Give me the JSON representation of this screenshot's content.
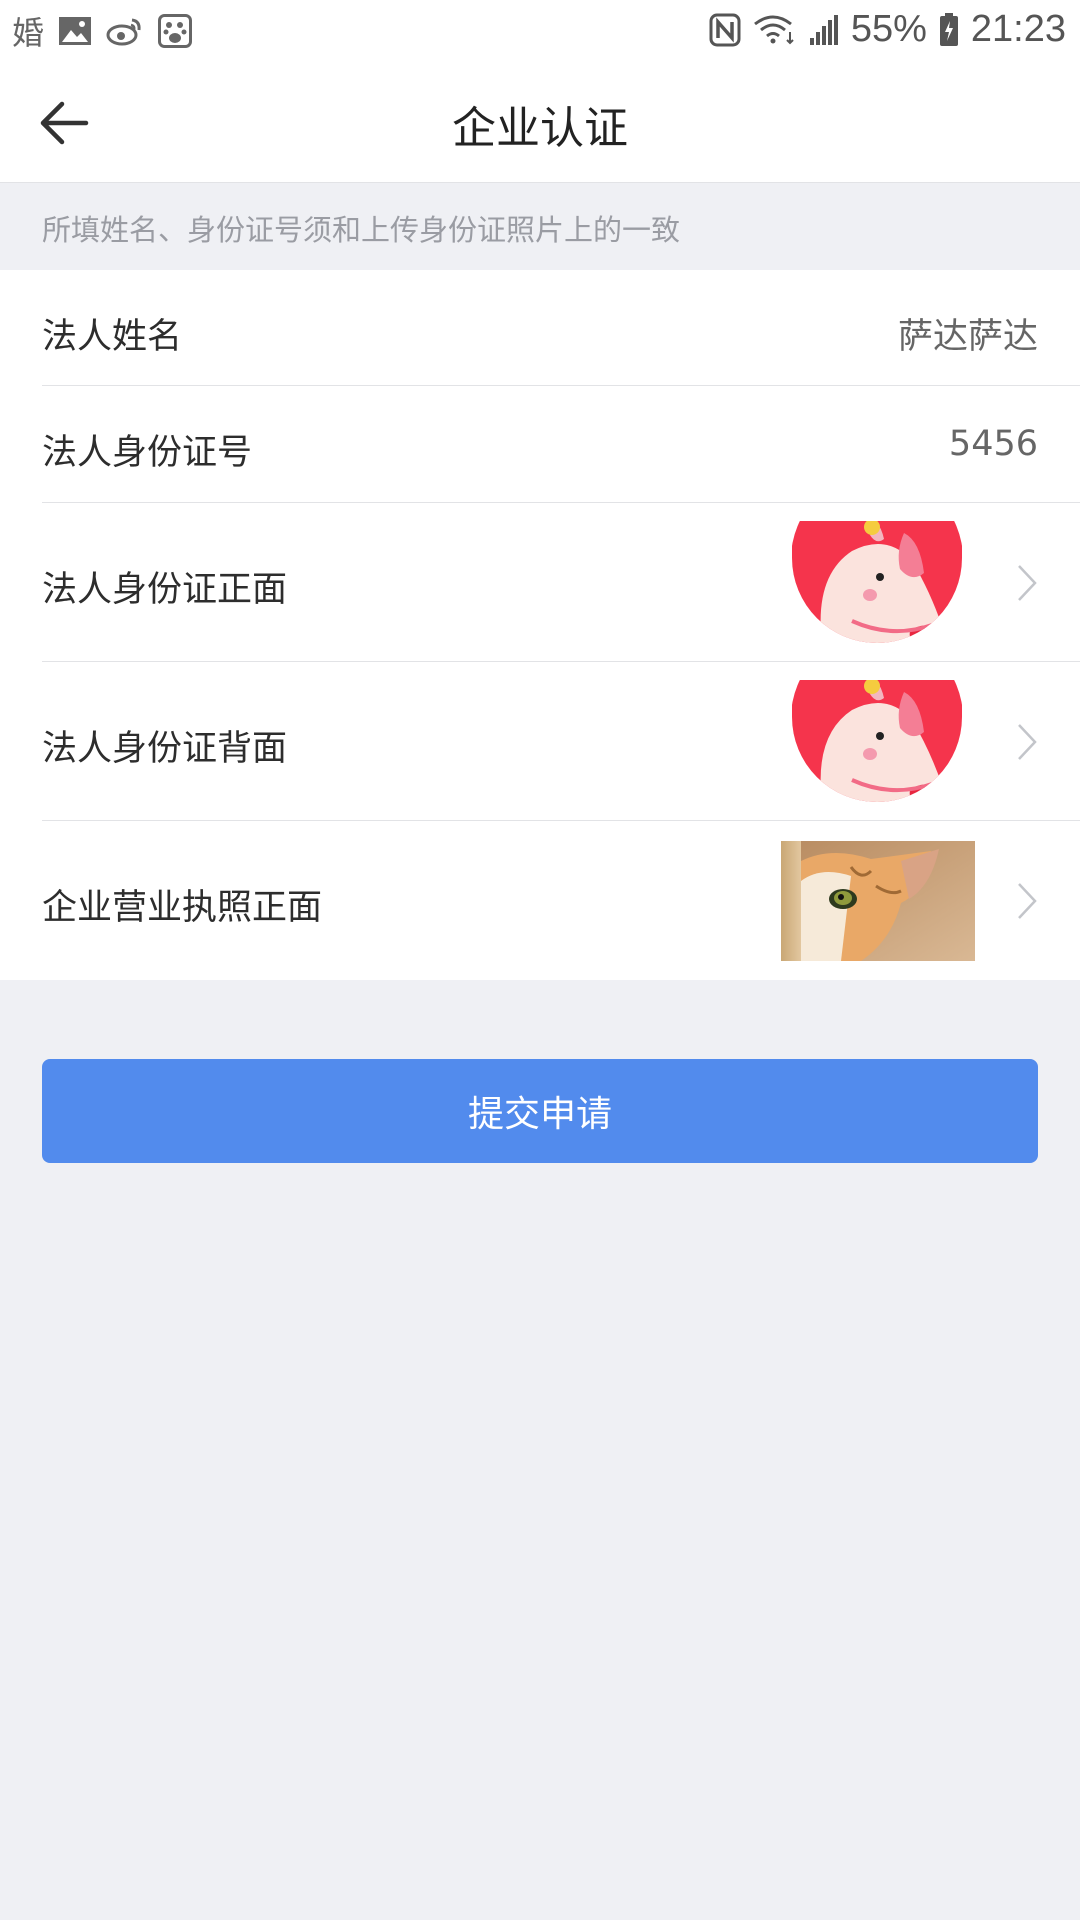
{
  "status_bar": {
    "left_char": "婚",
    "icons_left": [
      "image-icon",
      "weibo-icon",
      "baidu-icon"
    ],
    "icons_right": [
      "nfc-icon",
      "wifi-icon",
      "signal-icon",
      "battery-icon"
    ],
    "battery": "55%",
    "time": "21:23"
  },
  "header": {
    "title": "企业认证",
    "back_icon": "arrow-left-icon"
  },
  "notice": "所填姓名、身份证号须和上传身份证照片上的一致",
  "form": {
    "name_label": "法人姓名",
    "name_value": "萨达萨达",
    "id_label": "法人身份证号",
    "id_value": "5456",
    "id_front_label": "法人身份证正面",
    "id_back_label": "法人身份证背面",
    "license_label": "企业营业执照正面"
  },
  "submit_label": "提交申请",
  "colors": {
    "accent": "#528bed",
    "background": "#eff0f4",
    "thumb_red": "#f5344c"
  }
}
